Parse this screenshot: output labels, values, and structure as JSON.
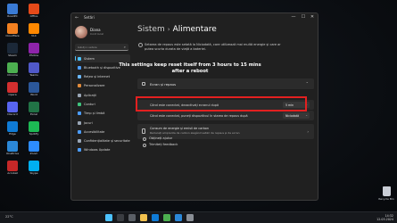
{
  "desktop": {
    "icons": [
      {
        "label": "RoadPC",
        "color": "#3a7bd5"
      },
      {
        "label": "Cloudflare",
        "color": "#f38020"
      },
      {
        "label": "Steam",
        "color": "#1b2838"
      },
      {
        "label": "Chrome",
        "color": "#4caf50"
      },
      {
        "label": "Opera",
        "color": "#d32f2f"
      },
      {
        "label": "Discord",
        "color": "#5865f2"
      },
      {
        "label": "Edge",
        "color": "#0f7bd6"
      },
      {
        "label": "OneDrive",
        "color": "#2b88d8"
      },
      {
        "label": "Acrobat",
        "color": "#c62828"
      },
      {
        "label": "Office",
        "color": "#e64a19"
      },
      {
        "label": "VLC",
        "color": "#ff8800"
      },
      {
        "label": "Photos",
        "color": "#8e24aa"
      },
      {
        "label": "Teams",
        "color": "#5059c9"
      },
      {
        "label": "Word",
        "color": "#2b579a"
      },
      {
        "label": "Excel",
        "color": "#217346"
      },
      {
        "label": "Spotify",
        "color": "#1db954"
      },
      {
        "label": "Zoom",
        "color": "#2d8cff"
      },
      {
        "label": "Skype",
        "color": "#00aff0"
      }
    ],
    "recycle_bin_label": "Recycle Bin"
  },
  "window": {
    "app_title": "Setări",
    "controls": {
      "minimize": "—",
      "maximize": "☐",
      "close": "✕"
    }
  },
  "profile": {
    "name": "Diana",
    "account": "Cont local"
  },
  "search": {
    "placeholder": "Găsiți o setare"
  },
  "nav": [
    {
      "label": "Sistem",
      "color": "#4cc2ff",
      "active": true
    },
    {
      "label": "Bluetooth și dispozitive",
      "color": "#4c9dff"
    },
    {
      "label": "Rețea și internet",
      "color": "#6bb8ff"
    },
    {
      "label": "Personalizare",
      "color": "#e08a3a"
    },
    {
      "label": "Aplicații",
      "color": "#9aa6b5"
    },
    {
      "label": "Conturi",
      "color": "#3ec27c"
    },
    {
      "label": "Timp și limbă",
      "color": "#4c9dff"
    },
    {
      "label": "Jocuri",
      "color": "#9aa6b5"
    },
    {
      "label": "Accesibilitate",
      "color": "#4c9dff"
    },
    {
      "label": "Confidențialitate și securitate",
      "color": "#9aa6b5"
    },
    {
      "label": "Windows Update",
      "color": "#4c9dff"
    }
  ],
  "breadcrumb": {
    "parent": "Sistem",
    "separator": "›",
    "current": "Alimentare"
  },
  "notice": "Setarea de repaus este setată la Niciodată, care utilizează mai multă energie și care ar putea scurta durata de viață a bateriei.",
  "power_card": {
    "title": "Ecran și repaus",
    "rows": [
      {
        "label": "Când este conectat, dezactivați ecranul după",
        "value": "5 min"
      },
      {
        "label": "Când este conectat, puneți dispozitivul în starea de repaus după",
        "value": "Niciodată"
      }
    ]
  },
  "energy_card": {
    "title": "Consum de energie și emisii de carbon",
    "subtitle": "Reduceți amprenta de carbon alegând setări de repaus și de ecran"
  },
  "links": [
    {
      "label": "Obțineți ajutor"
    },
    {
      "label": "Trimiteți feedback"
    }
  ],
  "annotation": {
    "line1": "This settings keep reset itself from 3 hours to 15 mins",
    "line2": "after a reboot",
    "highlight_color": "#e32020"
  },
  "taskbar": {
    "left_text": "22°C",
    "apps": [
      {
        "name": "start",
        "color": "#4cc2ff"
      },
      {
        "name": "search",
        "color": "#3a3d42"
      },
      {
        "name": "task-view",
        "color": "#5a5f66"
      },
      {
        "name": "explorer",
        "color": "#f2c14e"
      },
      {
        "name": "edge",
        "color": "#0f7bd6"
      },
      {
        "name": "chrome",
        "color": "#4caf50"
      },
      {
        "name": "store",
        "color": "#2b88d8"
      },
      {
        "name": "settings",
        "color": "#8a8f96"
      }
    ],
    "tray_time": "14:32",
    "tray_date": "12.03.2024"
  }
}
